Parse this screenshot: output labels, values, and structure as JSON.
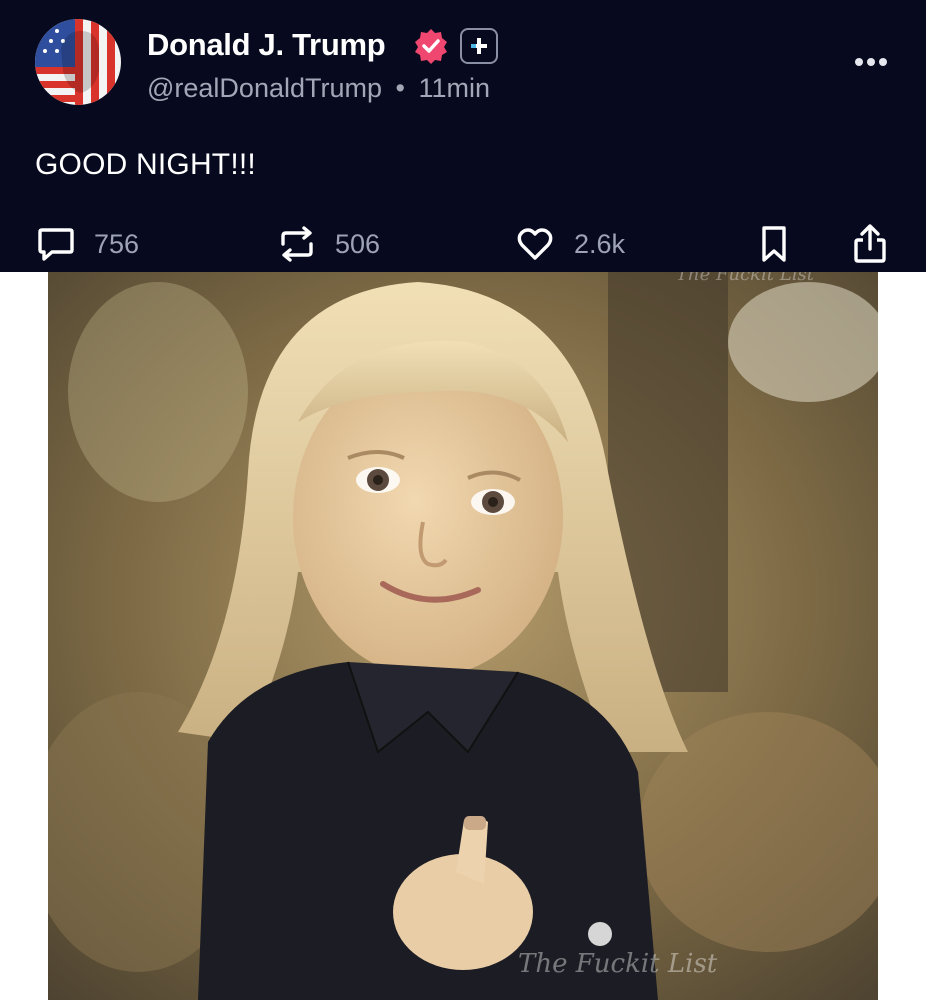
{
  "post": {
    "author": {
      "display_name": "Donald J. Trump",
      "handle": "@realDonaldTrump",
      "separator": "•",
      "time_ago": "11min",
      "avatar_icon": "flag-face-avatar",
      "verified_icon": "verified-badge-icon",
      "verified_color": "#ef476f"
    },
    "text": "GOOD NIGHT!!!",
    "actions": {
      "replies": {
        "icon": "reply-icon",
        "count": "756"
      },
      "retruths": {
        "icon": "retruth-icon",
        "count": "506"
      },
      "likes": {
        "icon": "heart-icon",
        "count": "2.6k"
      },
      "bookmark": {
        "icon": "bookmark-icon"
      },
      "share": {
        "icon": "share-icon"
      }
    },
    "image": {
      "watermark_top": "The Fuckit List",
      "watermark_bottom": "The Fuckit List"
    }
  },
  "colors": {
    "header_background": "#070a1e",
    "text_primary": "#ffffff",
    "text_secondary": "#a3a6b6"
  }
}
